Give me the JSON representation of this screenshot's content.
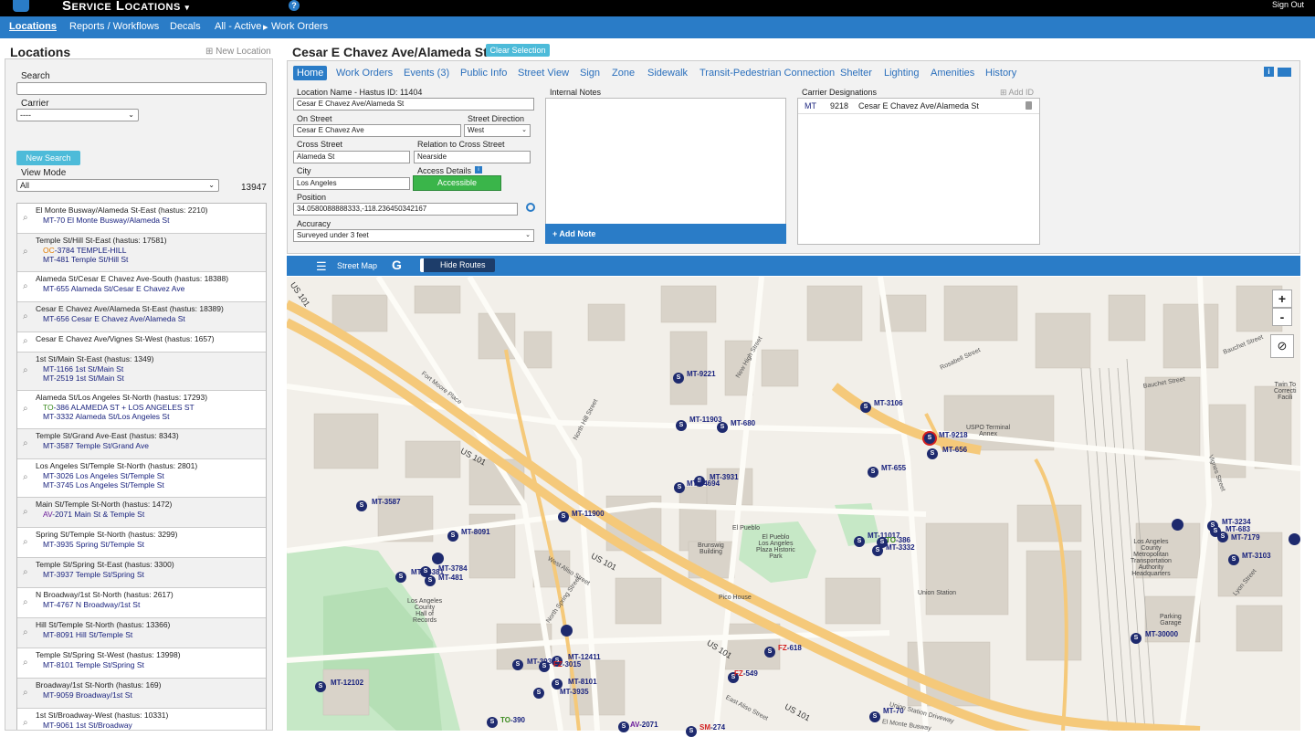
{
  "app": {
    "title": "Service Locations",
    "caret": "▾",
    "help": "?",
    "signout": "Sign Out"
  },
  "nav": {
    "locations": "Locations",
    "reports": "Reports / Workflows",
    "decals": "Decals",
    "all_active": "All - Active",
    "arrow": "▸",
    "work_orders": "Work Orders"
  },
  "left": {
    "title": "Locations",
    "new_location": "⊞ New Location",
    "search_label": "Search",
    "search_value": "",
    "carrier_label": "Carrier",
    "carrier_value": "----",
    "new_search": "New Search",
    "view_mode_label": "View Mode",
    "view_mode_value": "All",
    "count": "13947",
    "items": [
      {
        "title": "El Monte Busway/Alameda St-East (hastus: 2210)",
        "lines": [
          {
            "code": "MT",
            "color": "#1a237e",
            "text": "-70 El Monte Busway/Alameda St"
          }
        ]
      },
      {
        "title": "Temple St/Hill St-East (hastus: 17581)",
        "lines": [
          {
            "code": "OC",
            "color": "#e07b00",
            "text": "-3784 TEMPLE-HILL"
          },
          {
            "code": "MT",
            "color": "#1a237e",
            "text": "-481 Temple St/Hill St"
          }
        ]
      },
      {
        "title": "Alameda St/Cesar E Chavez Ave-South (hastus: 18388)",
        "lines": [
          {
            "code": "MT",
            "color": "#1a237e",
            "text": "-655 Alameda St/Cesar E Chavez Ave"
          }
        ]
      },
      {
        "title": "Cesar E Chavez Ave/Alameda St-East (hastus: 18389)",
        "lines": [
          {
            "code": "MT",
            "color": "#1a237e",
            "text": "-656 Cesar E Chavez Ave/Alameda St"
          }
        ]
      },
      {
        "title": "Cesar E Chavez Ave/Vignes St-West (hastus: 1657)",
        "lines": []
      },
      {
        "title": "1st St/Main St-East (hastus: 1349)",
        "lines": [
          {
            "code": "MT",
            "color": "#1a237e",
            "text": "-1166 1st St/Main St"
          },
          {
            "code": "MT",
            "color": "#1a237e",
            "text": "-2519 1st St/Main St"
          }
        ]
      },
      {
        "title": "Alameda St/Los Angeles St-North (hastus: 17293)",
        "lines": [
          {
            "code": "TO",
            "color": "#3a8a1e",
            "text": "-386 ALAMEDA ST + LOS ANGELES ST"
          },
          {
            "code": "MT",
            "color": "#1a237e",
            "text": "-3332 Alameda St/Los Angeles St"
          }
        ]
      },
      {
        "title": "Temple St/Grand Ave-East (hastus: 8343)",
        "lines": [
          {
            "code": "MT",
            "color": "#1a237e",
            "text": "-3587 Temple St/Grand Ave"
          }
        ]
      },
      {
        "title": "Los Angeles St/Temple St-North (hastus: 2801)",
        "lines": [
          {
            "code": "MT",
            "color": "#1a237e",
            "text": "-3026 Los Angeles St/Temple St"
          },
          {
            "code": "MT",
            "color": "#1a237e",
            "text": "-3745 Los Angeles St/Temple St"
          }
        ]
      },
      {
        "title": "Main St/Temple St-North (hastus: 1472)",
        "lines": [
          {
            "code": "AV",
            "color": "#6a1b9a",
            "text": "-2071 Main St & Temple St"
          }
        ]
      },
      {
        "title": "Spring St/Temple St-North (hastus: 3299)",
        "lines": [
          {
            "code": "MT",
            "color": "#1a237e",
            "text": "-3935 Spring St/Temple St"
          }
        ]
      },
      {
        "title": "Temple St/Spring St-East (hastus: 3300)",
        "lines": [
          {
            "code": "MT",
            "color": "#1a237e",
            "text": "-3937 Temple St/Spring St"
          }
        ]
      },
      {
        "title": "N Broadway/1st St-North (hastus: 2617)",
        "lines": [
          {
            "code": "MT",
            "color": "#1a237e",
            "text": "-4767 N Broadway/1st St"
          }
        ]
      },
      {
        "title": "Hill St/Temple St-North (hastus: 13366)",
        "lines": [
          {
            "code": "MT",
            "color": "#1a237e",
            "text": "-8091 Hill St/Temple St"
          }
        ]
      },
      {
        "title": "Temple St/Spring St-West (hastus: 13998)",
        "lines": [
          {
            "code": "MT",
            "color": "#1a237e",
            "text": "-8101 Temple St/Spring St"
          }
        ]
      },
      {
        "title": "Broadway/1st St-North (hastus: 169)",
        "lines": [
          {
            "code": "MT",
            "color": "#1a237e",
            "text": "-9059 Broadway/1st St"
          }
        ]
      },
      {
        "title": "1st St/Broadway-West (hastus: 10331)",
        "lines": [
          {
            "code": "MT",
            "color": "#1a237e",
            "text": "-9061 1st St/Broadway"
          }
        ]
      }
    ]
  },
  "detail": {
    "title": "Cesar E Chavez Ave/Alameda St",
    "clear_selection": "Clear Selection",
    "tabs": [
      "Home",
      "Work Orders",
      "Events (3)",
      "Public Info",
      "Street View",
      "Sign",
      "Zone",
      "Sidewalk",
      "Transit-Pedestrian Connection",
      "Shelter",
      "Lighting",
      "Amenities",
      "History"
    ],
    "location_name_label": "Location Name - Hastus ID: 11404",
    "location_name": "Cesar E Chavez Ave/Alameda St",
    "on_street_label": "On Street",
    "on_street": "Cesar E Chavez Ave",
    "street_direction_label": "Street Direction",
    "street_direction": "West",
    "cross_street_label": "Cross Street",
    "cross_street": "Alameda St",
    "relation_label": "Relation to Cross Street",
    "relation": "Nearside",
    "city_label": "City",
    "city": "Los Angeles",
    "access_label": "Access Details",
    "access": "Accessible",
    "position_label": "Position",
    "position": "34.0580088888333,-118.236450342167",
    "accuracy_label": "Accuracy",
    "accuracy": "Surveyed under 3 feet",
    "internal_notes_label": "Internal Notes",
    "add_note": "+ Add Note",
    "carrier_label": "Carrier Designations",
    "add_id": "⊞ Add ID",
    "carrier": {
      "code": "MT",
      "id": "9218",
      "name": "Cesar E Chavez Ave/Alameda St"
    }
  },
  "map": {
    "street_map": "Street Map",
    "hide_routes": "Hide Routes",
    "zoom_in": "+",
    "zoom_out": "-",
    "stops": [
      {
        "code": "MT",
        "num": "-9221"
      },
      {
        "code": "MT",
        "num": "-3106"
      },
      {
        "code": "MT",
        "num": "-11903"
      },
      {
        "code": "MT",
        "num": "-680"
      },
      {
        "code": "MT",
        "num": "-9218"
      },
      {
        "code": "MT",
        "num": "-656"
      },
      {
        "code": "MT",
        "num": "-655"
      },
      {
        "code": "MT",
        "num": "-3931"
      },
      {
        "code": "MT",
        "num": "-14694"
      },
      {
        "code": "MT",
        "num": "-3587"
      },
      {
        "code": "MT",
        "num": "-11900"
      },
      {
        "code": "MT",
        "num": "-8091"
      },
      {
        "code": "MT",
        "num": "-16381"
      },
      {
        "code": "MT",
        "num": "-3784"
      },
      {
        "code": "MT",
        "num": "-481"
      },
      {
        "code": "MT",
        "num": "-11017"
      },
      {
        "code": "TO",
        "num": "-386"
      },
      {
        "code": "MT",
        "num": "-3332"
      },
      {
        "code": "MT",
        "num": "-3234"
      },
      {
        "code": "MT",
        "num": "-683"
      },
      {
        "code": "MT",
        "num": "-7179"
      },
      {
        "code": "MT",
        "num": "-3103"
      },
      {
        "code": "MT",
        "num": "-30000"
      },
      {
        "code": "FZ",
        "num": "-618"
      },
      {
        "code": "FZ",
        "num": "-549"
      },
      {
        "code": "MT",
        "num": "-12411"
      },
      {
        "code": "MT",
        "num": "-3937"
      },
      {
        "code": "FZ",
        "num": "-3015"
      },
      {
        "code": "MT",
        "num": "-8101"
      },
      {
        "code": "MT",
        "num": "-3935"
      },
      {
        "code": "MT",
        "num": "-12102"
      },
      {
        "code": "TO",
        "num": "-390"
      },
      {
        "code": "AV",
        "num": "-2071"
      },
      {
        "code": "SM",
        "num": "-274"
      },
      {
        "code": "MT",
        "num": "-70"
      }
    ],
    "places": {
      "uspo": "USPO Terminal\nAnnex",
      "el_pueblo": "El Pueblo",
      "plaza": "El Pueblo\nLos Angeles\nPlaza Historic\nPark",
      "brunswig": "Brunswig\nBuilding",
      "pico": "Pico House",
      "union": "Union Station",
      "hall": "Los Angeles\nCounty\nHall of\nRecords",
      "metro": "Los Angeles\nCounty\nMetropolitan\nTransportation\nAuthority\nHeadquarters",
      "parking": "Parking\nGarage",
      "twin": "Twin To\nCorrecti\nFacili"
    },
    "streets": {
      "us101a": "US 101",
      "us101b": "US 101",
      "us101c": "US 101",
      "us101d": "US 101",
      "fort_moore": "Fort Moore Place",
      "north_hill": "North Hill Street",
      "new_high": "New High Street",
      "west_aliso": "West Aliso Street",
      "east_aliso": "East Aliso Street",
      "union_dr": "Union Station Driveway",
      "bauchet": "Bauchet Street",
      "rosabell": "Rosabell Street",
      "vignes": "Vignes Street",
      "lyon": "Lyon Street",
      "north_spring": "North Spring Street",
      "el_monte": "El Monte Busway"
    }
  }
}
